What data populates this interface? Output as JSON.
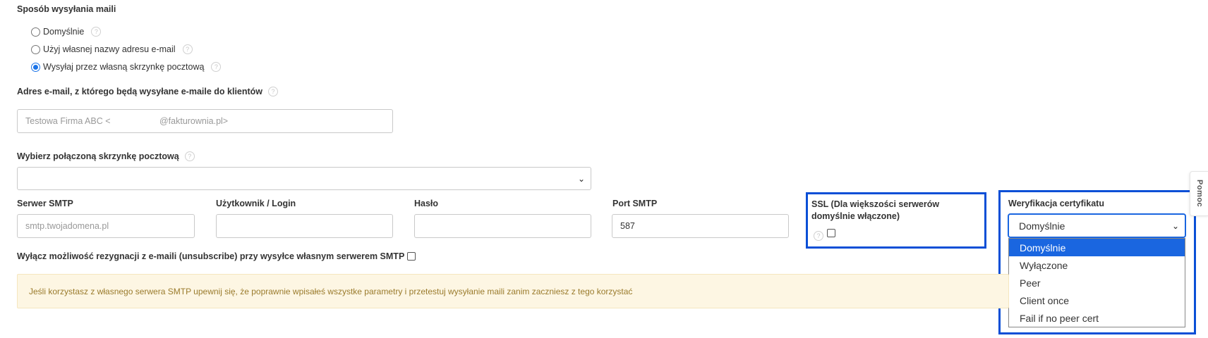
{
  "section_title": "Sposób wysyłania maili",
  "radios": [
    {
      "label": "Domyślnie",
      "checked": false
    },
    {
      "label": "Użyj własnej nazwy adresu e-mail",
      "checked": false
    },
    {
      "label": "Wysyłaj przez własną skrzynkę pocztową",
      "checked": true
    }
  ],
  "email_field": {
    "label": "Adres e-mail, z którego będą wysyłane e-maile do klientów",
    "value": "Testowa Firma ABC <                    @fakturownia.pl>"
  },
  "mailbox_select": {
    "label": "Wybierz połączoną skrzynkę pocztową",
    "value": ""
  },
  "smtp": {
    "server_label": "Serwer SMTP",
    "server_placeholder": "smtp.twojadomena.pl",
    "user_label": "Użytkownik / Login",
    "user_value": "",
    "password_label": "Hasło",
    "password_value": "",
    "port_label": "Port SMTP",
    "port_value": "587",
    "ssl_label": "SSL (Dla większości serwerów domyślnie włączone)",
    "ssl_checked": false
  },
  "cert_verification": {
    "label": "Weryfikacja certyfikatu",
    "selected": "Domyślnie",
    "options": [
      "Domyślnie",
      "Wyłączone",
      "Peer",
      "Client once",
      "Fail if no peer cert"
    ],
    "highlight_color": "#1a66e0"
  },
  "unsubscribe": {
    "label": "Wyłącz możliwość rezygnacji z e-maili (unsubscribe) przy wysyłce własnym serwerem SMTP",
    "checked": false
  },
  "alert_text": "Jeśli korzystasz z własnego serwera SMTP upewnij się, że poprawnie wpisałeś wszystke parametry i przetestuj wysyłanie maili zanim zaczniesz z tego korzystać",
  "help_tab_label": "Pomoc",
  "annotation_color": "#0a4fd6",
  "icons": {
    "help": "help-circle-icon",
    "chevron": "chevron-down-icon"
  }
}
